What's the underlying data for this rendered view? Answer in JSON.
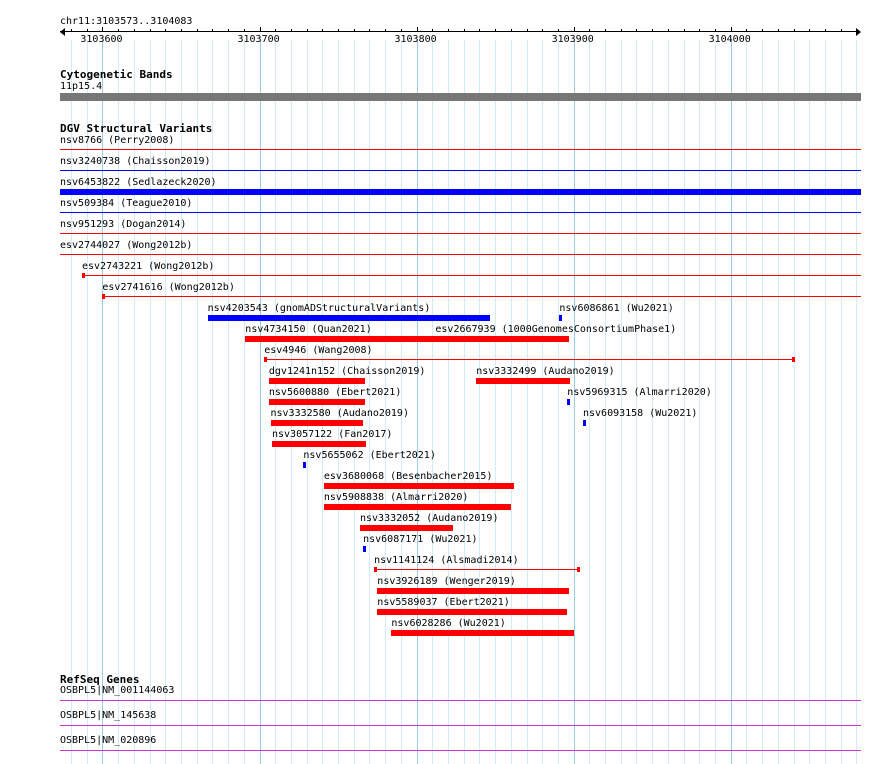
{
  "region": {
    "label": "chr11:3103573..3104083",
    "start": 3103573,
    "end": 3104083,
    "ticks": [
      {
        "pos": 3103600,
        "label": "3103600"
      },
      {
        "pos": 3103700,
        "label": "3103700"
      },
      {
        "pos": 3103800,
        "label": "3103800"
      },
      {
        "pos": 3103900,
        "label": "3103900"
      },
      {
        "pos": 3104000,
        "label": "3104000"
      }
    ]
  },
  "colors": {
    "loss": "#ff0000",
    "gain": "#0000ff",
    "band": "#777777",
    "gene": "#cc33cc",
    "grid": "#aadcf0"
  },
  "cytoband": {
    "title": "Cytogenetic Bands",
    "band_label": "11p15.4"
  },
  "dgv": {
    "title": "DGV Structural Variants",
    "variants": [
      {
        "label": "nsv8766 (Perry2008)",
        "type": "loss",
        "start": 3103573,
        "end": 3104083,
        "style": "line",
        "labelStart": 3103573
      },
      {
        "label": "nsv3240738 (Chaisson2019)",
        "type": "gain",
        "start": 3103573,
        "end": 3104083,
        "style": "line",
        "labelStart": 3103573
      },
      {
        "label": "nsv6453822 (Sedlazeck2020)",
        "type": "gain",
        "start": 3103573,
        "end": 3104083,
        "style": "thick",
        "labelStart": 3103573
      },
      {
        "label": "nsv509384 (Teague2010)",
        "type": "gain",
        "start": 3103573,
        "end": 3104083,
        "style": "line",
        "labelStart": 3103573
      },
      {
        "label": "nsv951293 (Dogan2014)",
        "type": "loss",
        "start": 3103573,
        "end": 3104083,
        "style": "line",
        "labelStart": 3103573
      },
      {
        "label": "esv2744027 (Wong2012b)",
        "type": "loss",
        "start": 3103573,
        "end": 3104083,
        "style": "line",
        "labelStart": 3103573
      },
      {
        "label": "esv2743221 (Wong2012b)",
        "type": "loss",
        "start": 3103587,
        "end": 3104083,
        "style": "line",
        "labelStart": 3103587
      },
      {
        "label": "esv2741616 (Wong2012b)",
        "type": "loss",
        "start": 3103600,
        "end": 3104083,
        "style": "line",
        "labelStart": 3103600
      },
      {
        "label": "nsv4203543 (gnomADStructuralVariants)",
        "type": "gain",
        "start": 3103667,
        "end": 3103847,
        "style": "thick",
        "labelStart": 3103667
      },
      {
        "label": "nsv6086861 (Wu2021)",
        "type": "gain",
        "start": 3103891,
        "end": 3103892,
        "style": "thick",
        "labelStart": 3103891
      },
      {
        "label": "nsv4734150 (Quan2021)",
        "type": "loss",
        "start": 3103691,
        "end": 3103809,
        "style": "thick",
        "labelStart": 3103691
      },
      {
        "label": "esv2667939 (1000GenomesConsortiumPhase1)",
        "type": "loss",
        "start": 3103809,
        "end": 3103897,
        "style": "thick",
        "labelStart": 3103812
      },
      {
        "label": "esv4946 (Wang2008)",
        "type": "loss",
        "start": 3103703,
        "end": 3104041,
        "style": "line",
        "labelStart": 3103703
      },
      {
        "label": "dgv1241n152 (Chaisson2019)",
        "type": "loss",
        "start": 3103706,
        "end": 3103767,
        "style": "thick",
        "labelStart": 3103706
      },
      {
        "label": "nsv3332499 (Audano2019)",
        "type": "loss",
        "start": 3103838,
        "end": 3103898,
        "style": "thick",
        "labelStart": 3103838
      },
      {
        "label": "nsv5600880 (Ebert2021)",
        "type": "loss",
        "start": 3103706,
        "end": 3103767,
        "style": "thick",
        "labelStart": 3103706
      },
      {
        "label": "nsv5969315 (Almarri2020)",
        "type": "gain",
        "start": 3103896,
        "end": 3103898,
        "style": "thick",
        "labelStart": 3103896
      },
      {
        "label": "nsv3332580 (Audano2019)",
        "type": "loss",
        "start": 3103707,
        "end": 3103766,
        "style": "thick",
        "labelStart": 3103707
      },
      {
        "label": "nsv6093158 (Wu2021)",
        "type": "gain",
        "start": 3103906,
        "end": 3103908,
        "style": "thick",
        "labelStart": 3103906
      },
      {
        "label": "nsv3057122 (Fan2017)",
        "type": "loss",
        "start": 3103708,
        "end": 3103768,
        "style": "thick",
        "labelStart": 3103708
      },
      {
        "label": "nsv5655062 (Ebert2021)",
        "type": "gain",
        "start": 3103728,
        "end": 3103729,
        "style": "thick",
        "labelStart": 3103728
      },
      {
        "label": "esv3680068 (Besenbacher2015)",
        "type": "loss",
        "start": 3103741,
        "end": 3103862,
        "style": "thick",
        "labelStart": 3103741
      },
      {
        "label": "nsv5908838 (Almarri2020)",
        "type": "loss",
        "start": 3103741,
        "end": 3103860,
        "style": "thick",
        "labelStart": 3103741
      },
      {
        "label": "nsv3332052 (Audano2019)",
        "type": "loss",
        "start": 3103764,
        "end": 3103823,
        "style": "thick",
        "labelStart": 3103764
      },
      {
        "label": "nsv6087171 (Wu2021)",
        "type": "gain",
        "start": 3103766,
        "end": 3103767,
        "style": "thick",
        "labelStart": 3103766
      },
      {
        "label": "nsv1141124 (Alsmadi2014)",
        "type": "loss",
        "start": 3103773,
        "end": 3103904,
        "style": "line",
        "labelStart": 3103773
      },
      {
        "label": "nsv3926189 (Wenger2019)",
        "type": "loss",
        "start": 3103775,
        "end": 3103897,
        "style": "thick",
        "labelStart": 3103775
      },
      {
        "label": "nsv5589037 (Ebert2021)",
        "type": "loss",
        "start": 3103775,
        "end": 3103896,
        "style": "thick",
        "labelStart": 3103775
      },
      {
        "label": "nsv6028286 (Wu2021)",
        "type": "loss",
        "start": 3103784,
        "end": 3103900,
        "style": "thick",
        "labelStart": 3103784
      }
    ],
    "rows": [
      [
        0
      ],
      [
        1
      ],
      [
        2
      ],
      [
        3
      ],
      [
        4
      ],
      [
        5
      ],
      [
        6
      ],
      [
        7
      ],
      [
        8,
        9
      ],
      [
        10,
        11
      ],
      [
        12
      ],
      [
        13,
        14
      ],
      [
        15,
        16
      ],
      [
        17,
        18
      ],
      [
        19
      ],
      [
        20
      ],
      [
        21
      ],
      [
        22
      ],
      [
        23
      ],
      [
        24
      ],
      [
        25
      ],
      [
        26
      ],
      [
        27
      ],
      [
        28
      ]
    ]
  },
  "refseq": {
    "title": "RefSeq Genes",
    "genes": [
      {
        "label": "OSBPL5|NM_001144063"
      },
      {
        "label": "OSBPL5|NM_145638"
      },
      {
        "label": "OSBPL5|NM_020896"
      }
    ]
  }
}
